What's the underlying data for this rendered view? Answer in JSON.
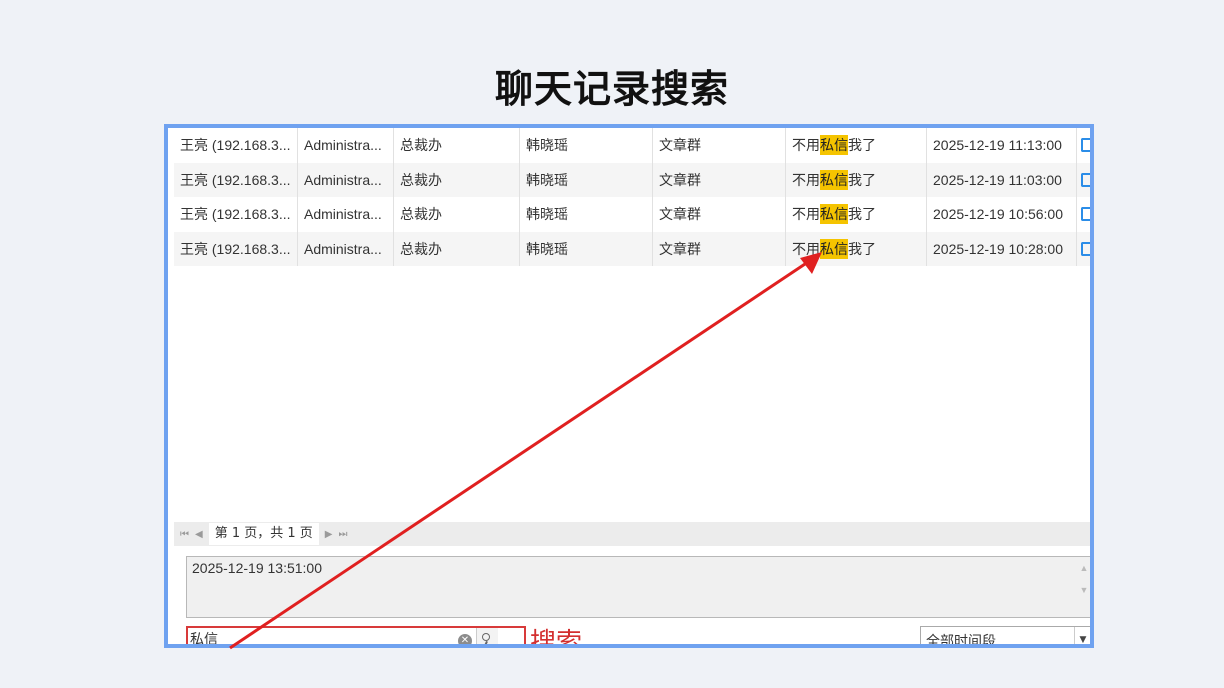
{
  "title": "聊天记录搜索",
  "table": {
    "rows": [
      {
        "sender": "王亮 (192.168.3...",
        "account": "Administra...",
        "department": "总裁办",
        "receiver": "韩晓瑶",
        "group": "文章群",
        "msg_pre": "不用",
        "msg_hl": "私信",
        "msg_post": "我了",
        "time": "2025-12-19 11:13:00"
      },
      {
        "sender": "王亮 (192.168.3...",
        "account": "Administra...",
        "department": "总裁办",
        "receiver": "韩晓瑶",
        "group": "文章群",
        "msg_pre": "不用",
        "msg_hl": "私信",
        "msg_post": "我了",
        "time": "2025-12-19 11:03:00"
      },
      {
        "sender": "王亮 (192.168.3...",
        "account": "Administra...",
        "department": "总裁办",
        "receiver": "韩晓瑶",
        "group": "文章群",
        "msg_pre": "不用",
        "msg_hl": "私信",
        "msg_post": "我了",
        "time": "2025-12-19 10:56:00"
      },
      {
        "sender": "王亮 (192.168.3...",
        "account": "Administra...",
        "department": "总裁办",
        "receiver": "韩晓瑶",
        "group": "文章群",
        "msg_pre": "不用",
        "msg_hl": "私信",
        "msg_post": "我了",
        "time": "2025-12-19 10:28:00"
      }
    ]
  },
  "pager": {
    "first_icon": "first-page-icon",
    "prev_icon": "prev-page-icon",
    "next_icon": "next-page-icon",
    "last_icon": "last-page-icon",
    "text": "第 1 页，共 1 页"
  },
  "detail": {
    "timestamp": "2025-12-19 13:51:00"
  },
  "search": {
    "value": "私信",
    "label": "搜索",
    "icon": "search-icon"
  },
  "time_filter": {
    "selected": "全部时间段"
  },
  "colors": {
    "frame": "#6fa2f0",
    "highlight": "#f5c400",
    "annotation": "#d32f2f"
  }
}
